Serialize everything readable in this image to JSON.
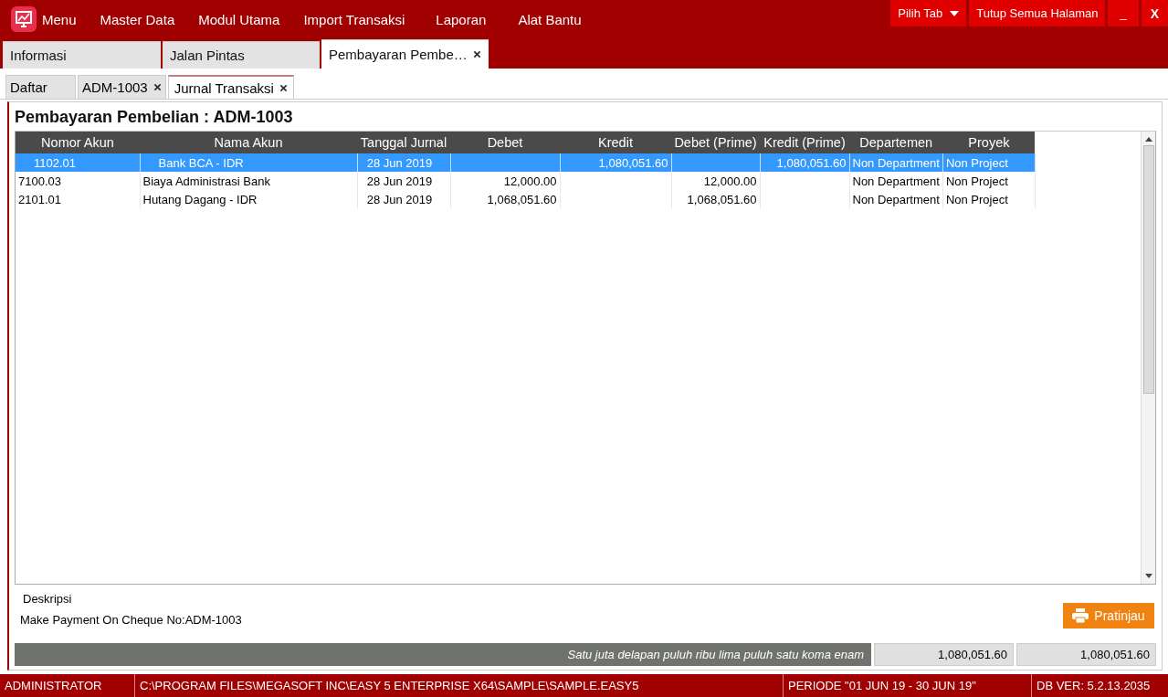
{
  "menu": {
    "items": [
      "Menu",
      "Master Data",
      "Modul Utama",
      "Import Transaksi",
      "Laporan",
      "Alat Bantu"
    ],
    "buttons": [
      {
        "label": "Pilih Tab",
        "kind": "dropdown"
      },
      {
        "label": "Tutup Semua Halaman",
        "kind": "plain"
      },
      {
        "label": "_",
        "kind": "plain"
      },
      {
        "label": "X",
        "kind": "bold"
      }
    ]
  },
  "tabs": [
    {
      "label": "Informasi",
      "selected": false,
      "closable": false
    },
    {
      "label": "Jalan Pintas",
      "selected": false,
      "closable": false
    },
    {
      "label": "Pembayaran Pembe…",
      "selected": true,
      "closable": true
    }
  ],
  "sub_tabs": [
    {
      "label": "Daftar",
      "selected": false,
      "closable": false
    },
    {
      "label": "ADM-1003",
      "selected": false,
      "closable": true
    },
    {
      "label": "Jurnal Transaksi",
      "selected": true,
      "closable": true
    }
  ],
  "title": "Pembayaran Pembelian : ADM-1003",
  "table": {
    "columns": [
      "Nomor Akun",
      "Nama Akun",
      "Tanggal Jurnal",
      "Debet",
      "Kredit",
      "Debet (Prime)",
      "Kredit (Prime)",
      "Departemen",
      "Proyek"
    ],
    "rows": [
      {
        "selected": true,
        "cells": [
          "1102.01",
          "Bank BCA - IDR",
          "28 Jun 2019",
          "",
          "1,080,051.60",
          "",
          "1,080,051.60",
          "Non Department",
          "Non Project"
        ]
      },
      {
        "selected": false,
        "cells": [
          "7100.03",
          "Biaya Administrasi Bank",
          "28 Jun 2019",
          "12,000.00",
          "",
          "12,000.00",
          "",
          "Non Department",
          "Non Project"
        ]
      },
      {
        "selected": false,
        "cells": [
          "2101.01",
          "Hutang Dagang - IDR",
          "28 Jun 2019",
          "1,068,051.60",
          "",
          "1,068,051.60",
          "",
          "Non Department",
          "Non Project"
        ]
      }
    ]
  },
  "description": {
    "label": "Deskripsi",
    "text": "Make Payment On Cheque No:ADM-1003"
  },
  "preview_button": "Pratinjau",
  "totals": {
    "in_words": "Satu juta delapan puluh ribu lima puluh satu koma enam",
    "debet": "1,080,051.60",
    "kredit": "1,080,051.60"
  },
  "status_bar": [
    "ADMINISTRATOR",
    "C:\\PROGRAM FILES\\MEGASOFT INC\\EASY 5 ENTERPRISE X64\\SAMPLE\\SAMPLE.EASY5",
    "PERIODE \"01 JUN 19 - 30 JUN 19\"",
    "DB VER: 5.2.13.2035"
  ]
}
